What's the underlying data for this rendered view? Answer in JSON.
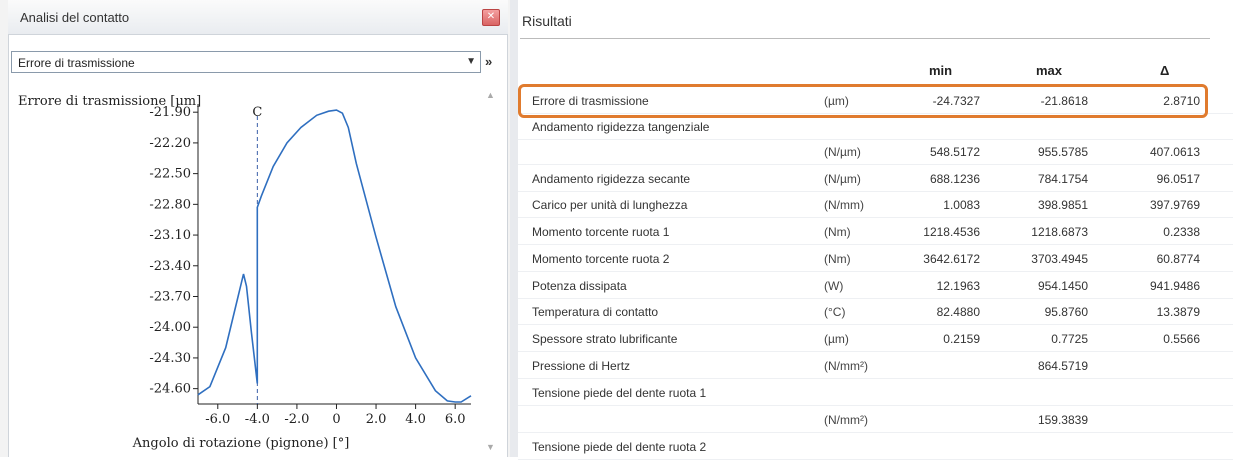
{
  "left_panel": {
    "title": "Analisi del contatto",
    "close_icon": "close-icon",
    "dropdown": {
      "selected": "Errore di trasmissione"
    },
    "expand_glyph": "»"
  },
  "chart_data": {
    "type": "line",
    "ylabel": "Errore di trasmissione [µm]",
    "xlabel": "Angolo di rotazione (pignone) [°]",
    "annotation": "C",
    "annotation_x": -4.0,
    "y_ticks": [
      "-21.90",
      "-22.20",
      "-22.50",
      "-22.80",
      "-23.10",
      "-23.40",
      "-23.70",
      "-24.00",
      "-24.30",
      "-24.60"
    ],
    "x_ticks": [
      "-6.0",
      "-4.0",
      "-2.0",
      "0",
      "2.0",
      "4.0",
      "6.0"
    ],
    "xlim": [
      -7.0,
      6.8
    ],
    "ylim": [
      -24.75,
      -21.82
    ],
    "grid": false,
    "series": [
      {
        "x": [
          -7.0,
          -6.4,
          -5.6,
          -5.0,
          -4.7,
          -4.55,
          -4.3,
          -4.0,
          -4.0,
          -3.8,
          -3.2,
          -2.5,
          -1.8,
          -1.0,
          -0.4,
          0.0,
          0.3,
          0.6,
          1.0,
          2.0,
          3.0,
          4.0,
          5.0,
          5.6,
          6.0,
          6.3,
          6.8
        ],
        "y": [
          -24.66,
          -24.58,
          -24.2,
          -23.72,
          -23.48,
          -23.6,
          -24.05,
          -24.55,
          -22.83,
          -22.72,
          -22.43,
          -22.2,
          -22.05,
          -21.93,
          -21.89,
          -21.88,
          -21.91,
          -22.05,
          -22.4,
          -23.12,
          -23.8,
          -24.3,
          -24.62,
          -24.72,
          -24.73,
          -24.73,
          -24.67
        ]
      }
    ]
  },
  "results": {
    "title": "Risultati",
    "columns": {
      "min": "min",
      "max": "max",
      "delta": "Δ"
    },
    "rows": [
      {
        "label": "Errore di trasmissione",
        "unit": "(µm)",
        "min": "-24.7327",
        "max": "-21.8618",
        "delta": "2.8710"
      },
      {
        "label": "Andamento rigidezza tangenziale",
        "unit": "",
        "min": "",
        "max": "",
        "delta": ""
      },
      {
        "label": "",
        "unit": "(N/µm)",
        "min": "548.5172",
        "max": "955.5785",
        "delta": "407.0613"
      },
      {
        "label": "Andamento rigidezza secante",
        "unit": "(N/µm)",
        "min": "688.1236",
        "max": "784.1754",
        "delta": "96.0517"
      },
      {
        "label": "Carico per unità di lunghezza",
        "unit": "(N/mm)",
        "min": "1.0083",
        "max": "398.9851",
        "delta": "397.9769"
      },
      {
        "label": "Momento torcente ruota 1",
        "unit": "(Nm)",
        "min": "1218.4536",
        "max": "1218.6873",
        "delta": "0.2338"
      },
      {
        "label": "Momento torcente ruota 2",
        "unit": "(Nm)",
        "min": "3642.6172",
        "max": "3703.4945",
        "delta": "60.8774"
      },
      {
        "label": "Potenza dissipata",
        "unit": "(W)",
        "min": "12.1963",
        "max": "954.1450",
        "delta": "941.9486"
      },
      {
        "label": "Temperatura di contatto",
        "unit": "(°C)",
        "min": "82.4880",
        "max": "95.8760",
        "delta": "13.3879"
      },
      {
        "label": "Spessore strato lubrificante",
        "unit": "(µm)",
        "min": "0.2159",
        "max": "0.7725",
        "delta": "0.5566"
      },
      {
        "label": "Pressione di Hertz",
        "unit": "(N/mm²)",
        "min": "",
        "max": "864.5719",
        "delta": ""
      },
      {
        "label": "Tensione piede del dente ruota 1",
        "unit": "",
        "min": "",
        "max": "",
        "delta": ""
      },
      {
        "label": "",
        "unit": "(N/mm²)",
        "min": "",
        "max": "159.3839",
        "delta": ""
      },
      {
        "label": "Tensione piede del dente ruota 2",
        "unit": "",
        "min": "",
        "max": "",
        "delta": ""
      }
    ]
  },
  "colors": {
    "highlight": "#e07b2e",
    "curve": "#2f6fc0"
  }
}
